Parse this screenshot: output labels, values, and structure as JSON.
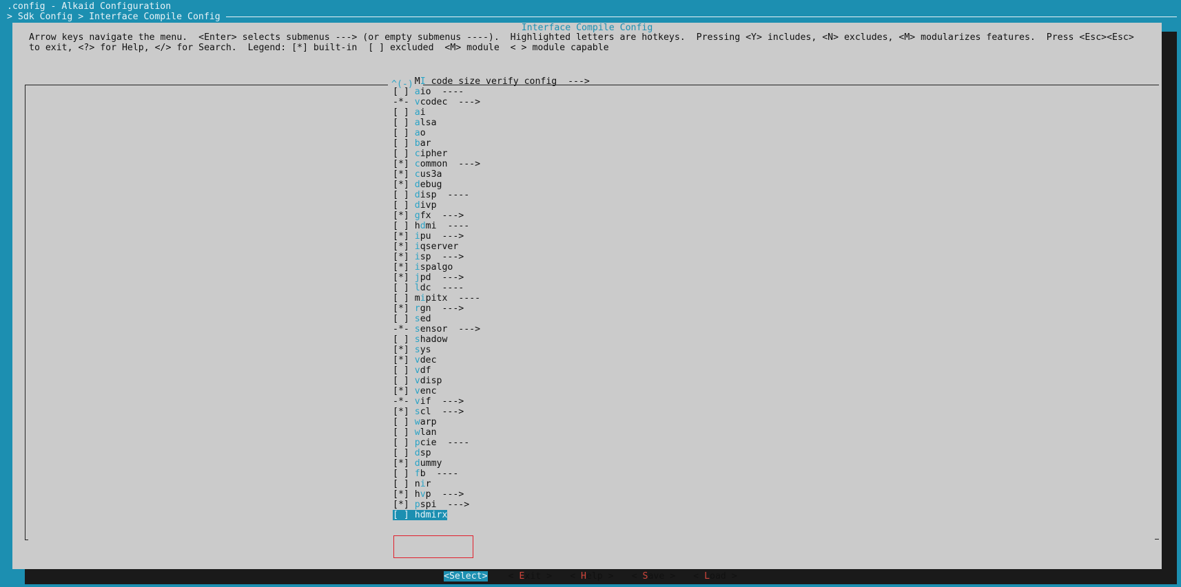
{
  "window": {
    "title": ".config - Alkaid Configuration",
    "breadcrumb": "> Sdk Config > Interface Compile Config"
  },
  "dialog": {
    "title": "Interface Compile Config",
    "help_line1": "Arrow keys navigate the menu.  <Enter> selects submenus ---> (or empty submenus ----).  Highlighted letters are hotkeys.  Pressing <Y> includes, <N> excludes, <M> modularizes features.  Press <Esc><Esc>",
    "help_line2": "to exit, <?> for Help, </> for Search.  Legend: [*] built-in  [ ] excluded  <M> module  < > module capable",
    "scroll_indicator": "^(-)"
  },
  "menu": {
    "items": [
      {
        "prefix": "   ",
        "hk": "MI",
        "hk_index": 1,
        "rest": " code size verify config  --->"
      },
      {
        "prefix": "[ ]",
        "name": "aio",
        "suffix": "  ----"
      },
      {
        "prefix": "-*-",
        "name": "vcodec",
        "suffix": "  --->"
      },
      {
        "prefix": "[ ]",
        "name": "ai",
        "suffix": ""
      },
      {
        "prefix": "[ ]",
        "name": "alsa",
        "suffix": ""
      },
      {
        "prefix": "[ ]",
        "name": "ao",
        "suffix": ""
      },
      {
        "prefix": "[ ]",
        "name": "bar",
        "suffix": ""
      },
      {
        "prefix": "[ ]",
        "name": "cipher",
        "suffix": ""
      },
      {
        "prefix": "[*]",
        "name": "common",
        "suffix": "  --->"
      },
      {
        "prefix": "[*]",
        "name": "cus3a",
        "suffix": ""
      },
      {
        "prefix": "[*]",
        "name": "debug",
        "suffix": ""
      },
      {
        "prefix": "[ ]",
        "name": "disp",
        "suffix": "  ----"
      },
      {
        "prefix": "[ ]",
        "name": "divp",
        "suffix": ""
      },
      {
        "prefix": "[*]",
        "name": "gfx",
        "suffix": "  --->"
      },
      {
        "prefix": "[ ]",
        "name": "hdmi",
        "suffix": "  ----",
        "hk_index": 1
      },
      {
        "prefix": "[*]",
        "name": "ipu",
        "suffix": "  --->"
      },
      {
        "prefix": "[*]",
        "name": "iqserver",
        "suffix": ""
      },
      {
        "prefix": "[*]",
        "name": "isp",
        "suffix": "  --->"
      },
      {
        "prefix": "[*]",
        "name": "ispalgo",
        "suffix": ""
      },
      {
        "prefix": "[*]",
        "name": "jpd",
        "suffix": "  --->"
      },
      {
        "prefix": "[ ]",
        "name": "ldc",
        "suffix": "  ----"
      },
      {
        "prefix": "[ ]",
        "name": "mipitx",
        "suffix": "  ----",
        "hk_index": 1
      },
      {
        "prefix": "[*]",
        "name": "rgn",
        "suffix": "  --->"
      },
      {
        "prefix": "[ ]",
        "name": "sed",
        "suffix": ""
      },
      {
        "prefix": "-*-",
        "name": "sensor",
        "suffix": "  --->"
      },
      {
        "prefix": "[ ]",
        "name": "shadow",
        "suffix": ""
      },
      {
        "prefix": "[*]",
        "name": "sys",
        "suffix": ""
      },
      {
        "prefix": "[*]",
        "name": "vdec",
        "suffix": ""
      },
      {
        "prefix": "[ ]",
        "name": "vdf",
        "suffix": ""
      },
      {
        "prefix": "[ ]",
        "name": "vdisp",
        "suffix": ""
      },
      {
        "prefix": "[*]",
        "name": "venc",
        "suffix": ""
      },
      {
        "prefix": "-*-",
        "name": "vif",
        "suffix": "  --->"
      },
      {
        "prefix": "[*]",
        "name": "scl",
        "suffix": "  --->"
      },
      {
        "prefix": "[ ]",
        "name": "warp",
        "suffix": ""
      },
      {
        "prefix": "[ ]",
        "name": "wlan",
        "suffix": ""
      },
      {
        "prefix": "[ ]",
        "name": "pcie",
        "suffix": "  ----"
      },
      {
        "prefix": "[ ]",
        "name": "dsp",
        "suffix": ""
      },
      {
        "prefix": "[*]",
        "name": "dummy",
        "suffix": ""
      },
      {
        "prefix": "[ ]",
        "name": "fb",
        "suffix": "  ----"
      },
      {
        "prefix": "[ ]",
        "name": "nir",
        "suffix": "",
        "hk_index": 1
      },
      {
        "prefix": "[*]",
        "name": "hvp",
        "suffix": "  --->",
        "hk_index": 1
      },
      {
        "prefix": "[*]",
        "name": "pspi",
        "suffix": "  --->"
      },
      {
        "prefix": "[ ]",
        "name": "hdmirx",
        "suffix": "",
        "hk_index": 1,
        "selected": true
      }
    ]
  },
  "buttons": [
    {
      "id": "select",
      "label": "Select",
      "hk_index": -1,
      "active": true
    },
    {
      "id": "exit",
      "label": "Exit",
      "hk_index": 0
    },
    {
      "id": "help",
      "label": "Help",
      "hk_index": 0
    },
    {
      "id": "save",
      "label": "Save",
      "hk_index": 0
    },
    {
      "id": "load",
      "label": "Load",
      "hk_index": 0
    }
  ],
  "colors": {
    "terminal_bg": "#1c8fb1",
    "dialog_bg": "#cbcbcb",
    "hotkey": "#2aa3c6",
    "button_hotkey": "#d0453b",
    "annotation_frame": "#e01e2a"
  }
}
